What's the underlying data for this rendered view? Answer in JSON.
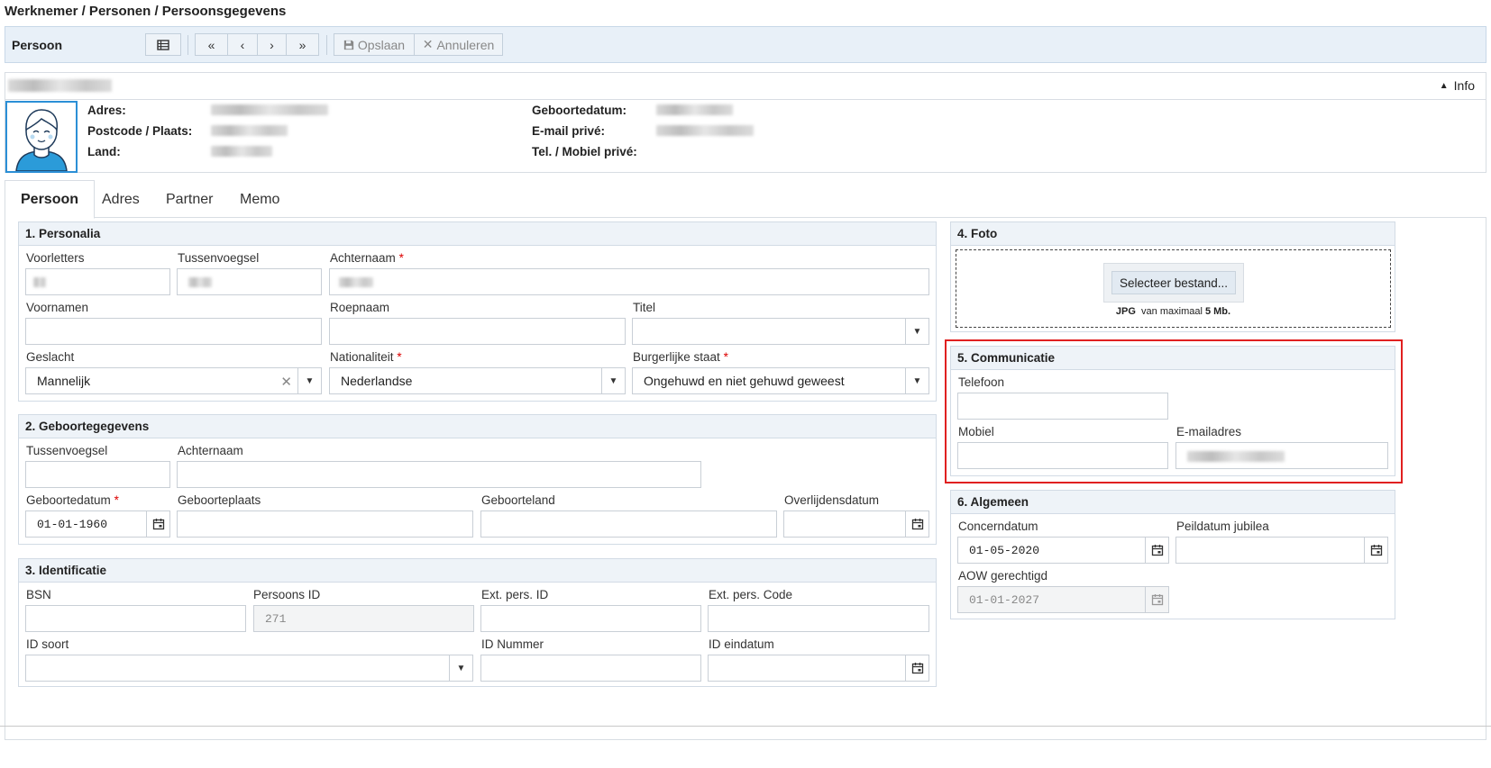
{
  "breadcrumb": "Werknemer / Personen / Persoonsgegevens",
  "toolbar": {
    "title": "Persoon",
    "save": "Opslaan",
    "cancel": "Annuleren"
  },
  "info": {
    "toggle": "Info",
    "adres_label": "Adres:",
    "postcode_label": "Postcode / Plaats:",
    "land_label": "Land:",
    "geboortedatum_label": "Geboortedatum:",
    "email_label": "E-mail privé:",
    "tel_label": "Tel. / Mobiel privé:"
  },
  "tabs": [
    "Persoon",
    "Adres",
    "Partner",
    "Memo"
  ],
  "personalia": {
    "title": "1. Personalia",
    "voorletters": "Voorletters",
    "tussenvoegsel": "Tussenvoegsel",
    "achternaam": "Achternaam",
    "voornamen": "Voornamen",
    "roepnaam": "Roepnaam",
    "titel": "Titel",
    "geslacht": "Geslacht",
    "geslacht_value": "Mannelijk",
    "nationaliteit": "Nationaliteit",
    "nationaliteit_value": "Nederlandse",
    "burgerlijke_staat": "Burgerlijke staat",
    "burgerlijke_staat_value": "Ongehuwd en niet gehuwd geweest"
  },
  "geboorte": {
    "title": "2. Geboortegegevens",
    "tussenvoegsel": "Tussenvoegsel",
    "achternaam": "Achternaam",
    "geboortedatum": "Geboortedatum",
    "geboortedatum_value": "01-01-1960",
    "geboorteplaats": "Geboorteplaats",
    "geboorteland": "Geboorteland",
    "overlijdensdatum": "Overlijdensdatum"
  },
  "identificatie": {
    "title": "3. Identificatie",
    "bsn": "BSN",
    "persoons_id": "Persoons ID",
    "persoons_id_value": "271",
    "ext_id": "Ext. pers. ID",
    "ext_code": "Ext. pers. Code",
    "id_soort": "ID soort",
    "id_nummer": "ID Nummer",
    "id_eindatum": "ID eindatum"
  },
  "foto": {
    "title": "4. Foto",
    "select": "Selecteer bestand...",
    "hint_type": "JPG",
    "hint_mid": "van maximaal",
    "hint_size": "5 Mb."
  },
  "communicatie": {
    "title": "5. Communicatie",
    "telefoon": "Telefoon",
    "mobiel": "Mobiel",
    "email": "E-mailadres"
  },
  "algemeen": {
    "title": "6. Algemeen",
    "concerndatum": "Concerndatum",
    "concerndatum_value": "01-05-2020",
    "peildatum": "Peildatum jubilea",
    "aow": "AOW gerechtigd",
    "aow_value": "01-01-2027"
  }
}
